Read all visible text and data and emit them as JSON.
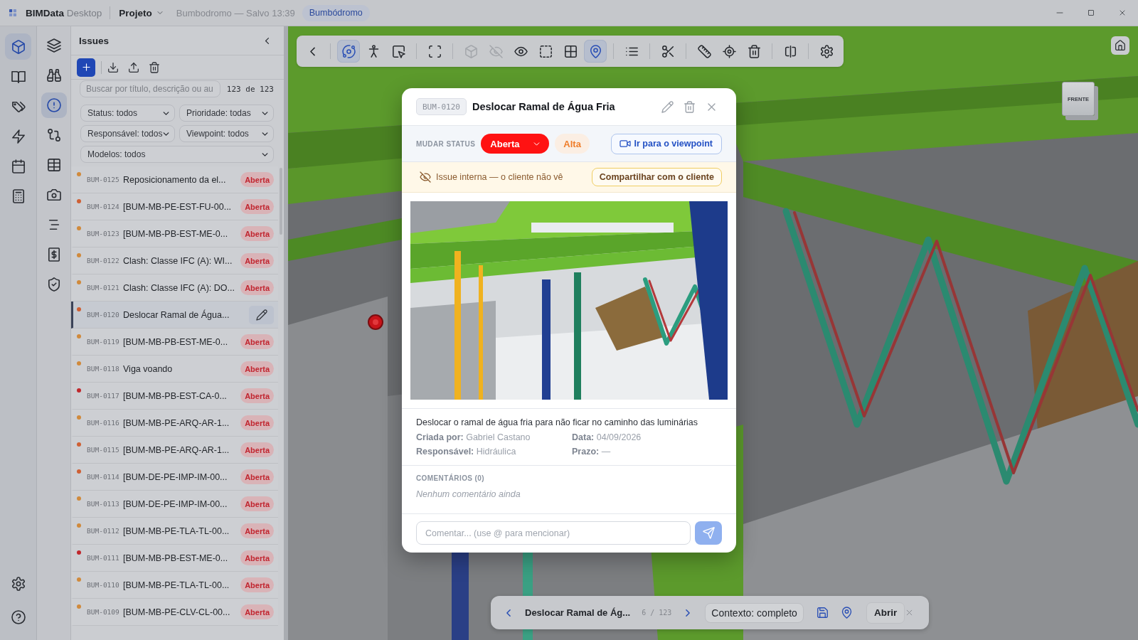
{
  "title_bar": {
    "app_name": "**BIMData** Desktop",
    "project_menu": "Projeto",
    "save_status": "Bumbodromo — Salvo 13:39",
    "project_tag": "Bumbódromo"
  },
  "primary_rail": {
    "items": [
      {
        "selected": true
      },
      {
        "selected": false
      },
      {
        "selected": false
      },
      {
        "selected": false
      },
      {
        "selected": false
      },
      {
        "selected": false
      }
    ]
  },
  "secondary_rail": {
    "items": [
      {
        "selected": false
      },
      {
        "selected": false
      },
      {
        "selected": true
      },
      {
        "selected": false
      },
      {
        "selected": false
      },
      {
        "selected": false
      },
      {
        "selected": false
      },
      {
        "selected": false
      },
      {
        "selected": false
      }
    ]
  },
  "issues_panel": {
    "title": "Issues",
    "search": {
      "placeholder": "Buscar por título, descrição ou au"
    },
    "result_count": "123 de 123",
    "filters": [
      {
        "value": "Status: todos"
      },
      {
        "value": "Prioridade: todas"
      },
      {
        "value": "Responsável: todos"
      },
      {
        "value": "Viewpoint: todos"
      },
      {
        "value": "Modelos: todos"
      }
    ],
    "issues": [
      {
        "id": "BUM-0125",
        "title": "Reposicionamento da el...",
        "status": "Aberta",
        "color": "#d08a3c",
        "selected": false
      },
      {
        "id": "BUM-0124",
        "title": "[BUM-MB-PE-EST-FU-00...",
        "status": "Aberta",
        "color": "#cf6034",
        "selected": false
      },
      {
        "id": "BUM-0123",
        "title": "[BUM-MB-PB-EST-ME-0...",
        "status": "Aberta",
        "color": "#d08a3c",
        "selected": false
      },
      {
        "id": "BUM-0122",
        "title": "Clash: Classe IFC (A): WI...",
        "status": "Aberta",
        "color": "#d08a3c",
        "selected": false
      },
      {
        "id": "BUM-0121",
        "title": "Clash: Classe IFC (A): DO...",
        "status": "Aberta",
        "color": "#d08a3c",
        "selected": false
      },
      {
        "id": "BUM-0120",
        "title": "Deslocar Ramal de Água...",
        "color": "#cf6034",
        "selected": true
      },
      {
        "id": "BUM-0119",
        "title": "[BUM-MB-PB-EST-ME-0...",
        "status": "Aberta",
        "color": "#d08a3c",
        "selected": false
      },
      {
        "id": "BUM-0118",
        "title": "Viga voando",
        "status": "Aberta",
        "color": "#d08a3c",
        "selected": false
      },
      {
        "id": "BUM-0117",
        "title": "[BUM-MB-PB-EST-CA-0...",
        "status": "Aberta",
        "color": "#c0282c",
        "selected": false
      },
      {
        "id": "BUM-0116",
        "title": "[BUM-MB-PE-ARQ-AR-1...",
        "status": "Aberta",
        "color": "#d08a3c",
        "selected": false
      },
      {
        "id": "BUM-0115",
        "title": "[BUM-MB-PE-ARQ-AR-1...",
        "status": "Aberta",
        "color": "#cf6034",
        "selected": false
      },
      {
        "id": "BUM-0114",
        "title": "[BUM-DE-PE-IMP-IM-00...",
        "status": "Aberta",
        "color": "#cf6034",
        "selected": false
      },
      {
        "id": "BUM-0113",
        "title": "[BUM-DE-PE-IMP-IM-00...",
        "status": "Aberta",
        "color": "#d08a3c",
        "selected": false
      },
      {
        "id": "BUM-0112",
        "title": "[BUM-MB-PE-TLA-TL-00...",
        "status": "Aberta",
        "color": "#d08a3c",
        "selected": false
      },
      {
        "id": "BUM-0111",
        "title": "[BUM-MB-PB-EST-ME-0...",
        "status": "Aberta",
        "color": "#c0282c",
        "selected": false
      },
      {
        "id": "BUM-0110",
        "title": "[BUM-MB-PE-TLA-TL-00...",
        "status": "Aberta",
        "color": "#d08a3c",
        "selected": false
      },
      {
        "id": "BUM-0109",
        "title": "[BUM-MB-PE-CLV-CL-00...",
        "status": "Aberta",
        "color": "#d08a3c",
        "selected": false
      }
    ]
  },
  "viewer_toolbar": {
    "groups": [
      {
        "tools": [
          {
            "selected": false,
            "disabled": false
          }
        ]
      },
      {
        "tools": [
          {
            "selected": true,
            "disabled": false
          },
          {
            "selected": false,
            "disabled": false
          },
          {
            "selected": false,
            "disabled": false
          }
        ]
      },
      {
        "tools": [
          {
            "selected": false,
            "disabled": false
          }
        ]
      },
      {
        "tools": [
          {
            "selected": false,
            "disabled": true
          },
          {
            "selected": false,
            "disabled": true
          },
          {
            "selected": false,
            "disabled": false
          },
          {
            "selected": false,
            "disabled": false
          },
          {
            "selected": false,
            "disabled": false
          },
          {
            "selected": true,
            "disabled": false
          }
        ]
      },
      {
        "tools": [
          {
            "selected": false,
            "disabled": false
          }
        ]
      },
      {
        "tools": [
          {
            "selected": false,
            "disabled": false
          }
        ]
      },
      {
        "tools": [
          {
            "selected": false,
            "disabled": false
          },
          {
            "selected": false,
            "disabled": false
          },
          {
            "selected": false,
            "disabled": false
          }
        ]
      },
      {
        "tools": [
          {
            "selected": false,
            "disabled": false
          }
        ]
      },
      {
        "tools": [
          {
            "selected": false,
            "disabled": false
          }
        ]
      }
    ]
  },
  "viewport": {
    "view_cube_label": "FRENTE"
  },
  "issue_dialog": {
    "id": "BUM-0120",
    "title": "Deslocar Ramal de Água Fria",
    "status_label": "MUDAR STATUS",
    "status": "Aberta",
    "priority": "Alta",
    "viewpoint_button": "Ir para o viewpoint",
    "visibility_notice": "Issue interna — o cliente não vê",
    "share_button": "Compartilhar com o cliente",
    "description": "Deslocar o ramal de água fria para não ficar no caminho das luminárias",
    "meta": [
      "**Criada por:** Gabriel Castano",
      "**Data:** 04/09/2026",
      "**Responsável:** Hidráulica",
      "**Prazo:** —"
    ],
    "comments_heading": "COMENTÁRIOS (0)",
    "comments_empty": "Nenhum comentário ainda",
    "comment_field": {
      "placeholder": "Comentar... (use @ para mencionar)"
    }
  },
  "issue_navigator": {
    "title": "Deslocar Ramal de Ág...",
    "position": "6 / 123",
    "context": "Contexto: completo",
    "open_button": "Abrir"
  }
}
